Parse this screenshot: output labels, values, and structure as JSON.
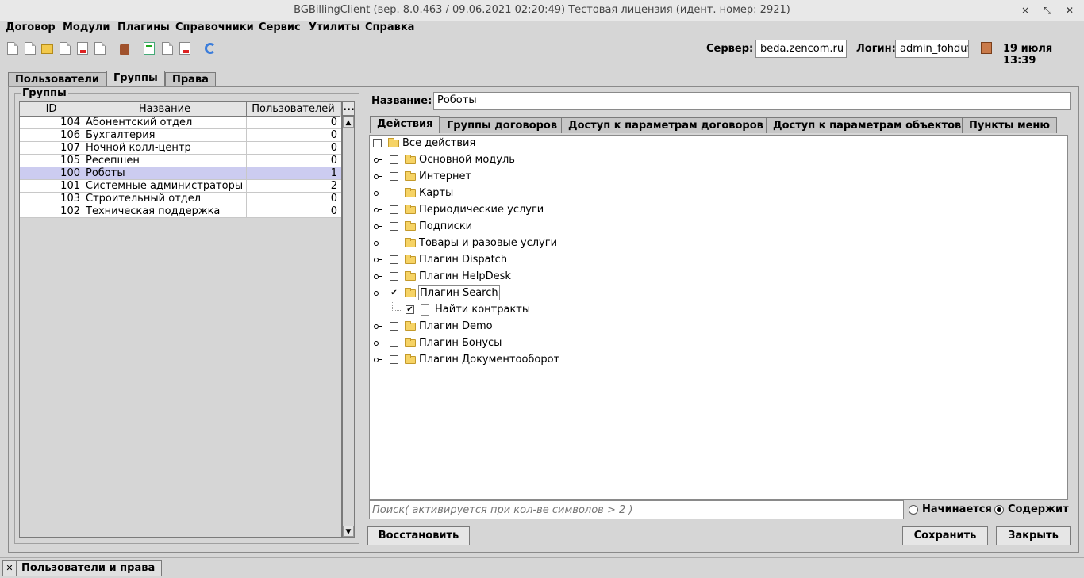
{
  "window": {
    "title": "BGBillingClient (вер. 8.0.463 / 09.06.2021 02:20:49) Тестовая лицензия (идент. номер: 2921)",
    "controls": [
      "×",
      "⤡",
      "✕"
    ]
  },
  "menu": [
    "Договор",
    "Модули",
    "Плагины",
    "Справочники",
    "Сервис",
    "Утилиты",
    "Справка"
  ],
  "toolbar": {
    "server_label": "Сервер:",
    "server_value": "beda.zencom.ru",
    "login_label": "Логин:",
    "login_value": "admin_fohdufa",
    "datetime": "19 июля 13:39"
  },
  "main_tabs": [
    "Пользователи",
    "Группы",
    "Права"
  ],
  "groups_panel": {
    "title": "Группы",
    "columns": [
      "ID",
      "Название",
      "Пользователей",
      "..."
    ],
    "rows": [
      {
        "id": "104",
        "name": "Абонентский отдел",
        "users": "0"
      },
      {
        "id": "106",
        "name": "Бухгалтерия",
        "users": "0"
      },
      {
        "id": "107",
        "name": "Ночной колл-центр",
        "users": "0"
      },
      {
        "id": "105",
        "name": "Ресепшен",
        "users": "0"
      },
      {
        "id": "100",
        "name": "Роботы",
        "users": "1"
      },
      {
        "id": "101",
        "name": "Системные администраторы",
        "users": "2"
      },
      {
        "id": "103",
        "name": "Строительный отдел",
        "users": "0"
      },
      {
        "id": "102",
        "name": "Техническая поддержка",
        "users": "0"
      }
    ],
    "selected_row": 4
  },
  "detail": {
    "name_label": "Название:",
    "name_value": "Роботы",
    "tabs": [
      "Действия",
      "Группы договоров",
      "Доступ к параметрам договоров",
      "Доступ к параметрам объектов",
      "Пункты меню"
    ],
    "tree": [
      {
        "label": "Все действия",
        "checked": false
      },
      {
        "label": "Основной модуль",
        "checked": false
      },
      {
        "label": "Интернет",
        "checked": false
      },
      {
        "label": "Карты",
        "checked": false
      },
      {
        "label": "Периодические услуги",
        "checked": false
      },
      {
        "label": "Подписки",
        "checked": false
      },
      {
        "label": "Товары и разовые услуги",
        "checked": false
      },
      {
        "label": "Плагин Dispatch",
        "checked": false
      },
      {
        "label": "Плагин HelpDesk",
        "checked": false
      },
      {
        "label": "Плагин Search",
        "checked": true
      },
      {
        "label": "Найти контракты",
        "checked": true
      },
      {
        "label": "Плагин Demo",
        "checked": false
      },
      {
        "label": "Плагин Бонусы",
        "checked": false
      },
      {
        "label": "Плагин Документооборот",
        "checked": false
      }
    ],
    "search_placeholder": "Поиск( активируется при кол-ве символов > 2 )",
    "radio_starts": "Начинается",
    "radio_contains": "Содержит",
    "radio_selected": "Содержит"
  },
  "buttons": {
    "restore": "Восстановить",
    "save": "Сохранить",
    "close": "Закрыть"
  },
  "window_tab": {
    "close_glyph": "✕",
    "label": "Пользователи и права"
  }
}
